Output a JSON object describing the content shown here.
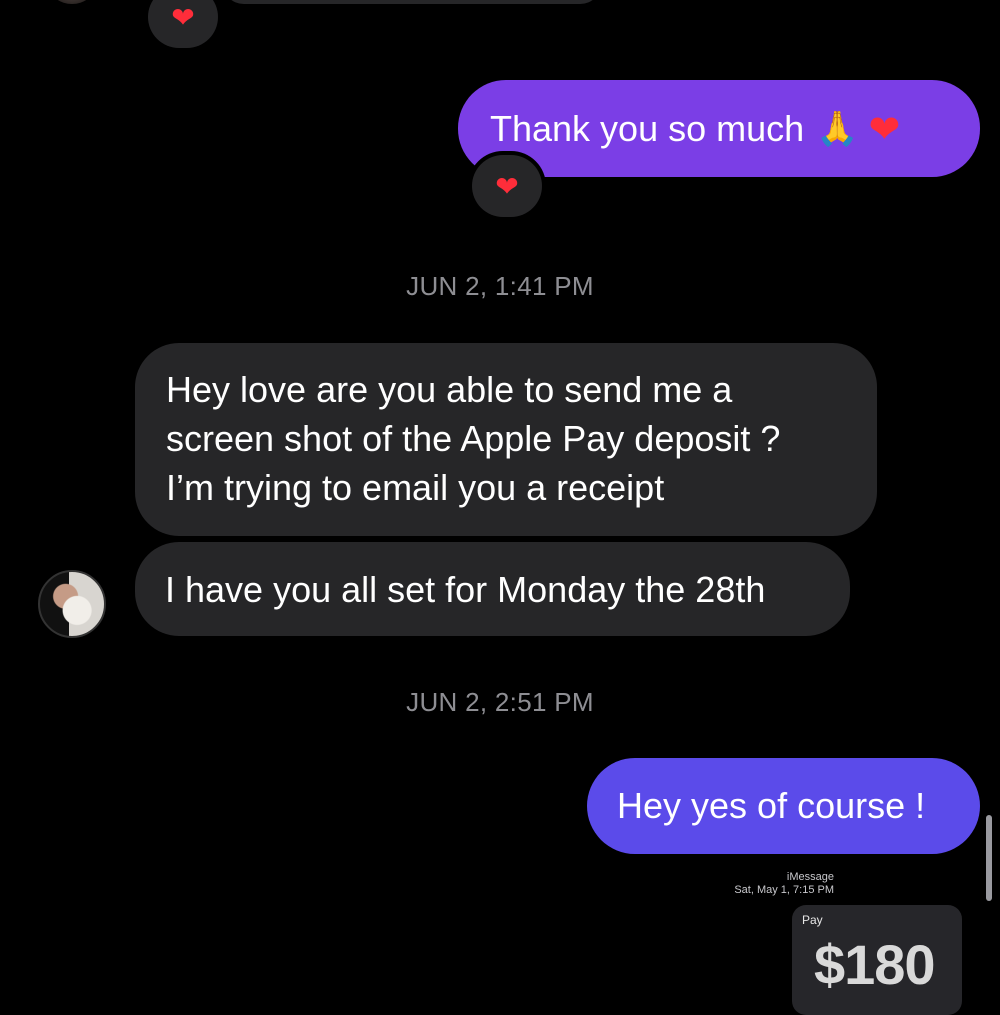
{
  "top": {
    "reaction_icon": "heart-icon"
  },
  "messages": {
    "outgoing_1": {
      "text": "Thank you so much",
      "emoji_pray": "🙏",
      "emoji_heart": "❤",
      "reaction": "❤"
    },
    "timestamp_1": "JUN 2, 1:41 PM",
    "incoming_1": {
      "lines": [
        "Hey love are you able to send me a",
        "screen shot of the Apple Pay deposit ?",
        "I’m trying to email you a receipt"
      ]
    },
    "incoming_2": {
      "text": "I have you all set for Monday the 28th"
    },
    "timestamp_2": "JUN 2, 2:51 PM",
    "outgoing_2": {
      "text": "Hey yes of course !"
    }
  },
  "attachment": {
    "service": "iMessage",
    "date": "Sat, May 1, 7:15 PM",
    "pay_apple_glyph": "",
    "pay_label": "Pay",
    "amount": "$180"
  },
  "colors": {
    "background": "#000000",
    "incoming_bubble": "#262628",
    "outgoing_purple": "#7b3ee6",
    "outgoing_blue": "#5b4bea",
    "timestamp": "#8e8e93",
    "reaction_heart": "#ff2d3a"
  }
}
